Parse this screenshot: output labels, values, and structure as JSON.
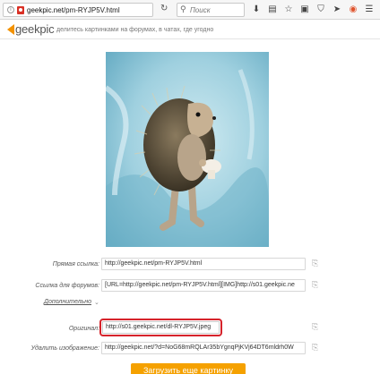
{
  "browser": {
    "url_host": "geekpic.net",
    "url_path": "/pm-RYJP5V.html",
    "search_placeholder": "Поиск",
    "toolbar_icons": [
      "download-icon",
      "bookmarks-list-icon",
      "star-icon",
      "reader-icon",
      "shield-icon",
      "send-icon",
      "avast-icon",
      "menu-icon"
    ]
  },
  "site": {
    "logo_text": "geekpic",
    "tagline": "делитесь картинками на форумах, в чатах, где угодно",
    "brand_color": "#f39200"
  },
  "photo": {
    "subject": "crocheted hedgehog toy holding a white mushroom on a blue blanket"
  },
  "links": [
    {
      "label": "Прямая ссылка:",
      "value": "http://geekpic.net/pm-RYJP5V.html"
    },
    {
      "label": "Ссылка для форумов:",
      "value": "[URL=http://geekpic.net/pm-RYJP5V.html][IMG]http://s01.geekpic.ne"
    }
  ],
  "more_label": "Дополнительно",
  "original": {
    "label": "Оригинал:",
    "value": "http://s01.geekpic.net/dl-RYJP5V.jpeg",
    "highlight_color": "#d6232b"
  },
  "delete": {
    "label": "Удалить изображение:",
    "value": "http://geekpic.net/?d=NoG68mRQLAr35bYgnqPjKVj64DT6mldrh0W"
  },
  "upload_button": "Загрузить еще картинку"
}
